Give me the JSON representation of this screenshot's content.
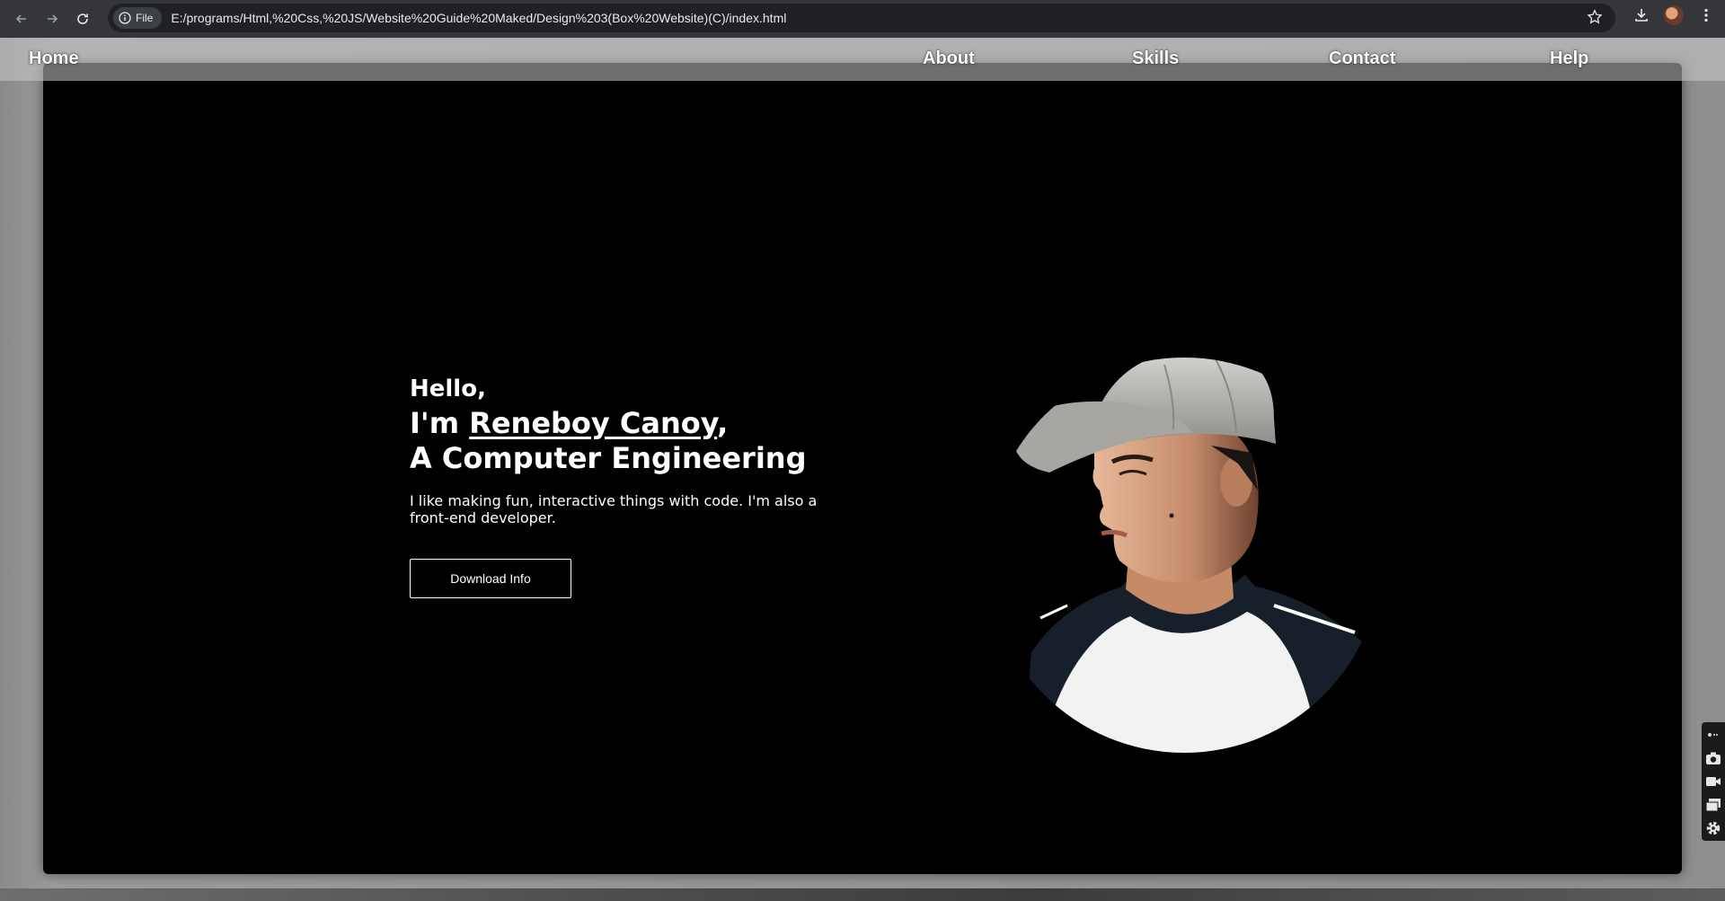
{
  "browser": {
    "scheme_chip": "File",
    "url": "E:/programs/Html,%20Css,%20JS/Website%20Guide%20Maked/Design%203(Box%20Website)(C)/index.html"
  },
  "nav": {
    "home": "Home",
    "about": "About",
    "skills": "Skills",
    "contact": "Contact",
    "help": "Help"
  },
  "hero": {
    "hello": "Hello,",
    "im_prefix": "I'm ",
    "name": "Reneboy Canoy",
    "name_suffix": ",",
    "role": "A Computer Engineering",
    "tagline": "I like making fun, interactive things with code. I'm also a front-end developer.",
    "button_label": "Download Info"
  },
  "icons": {
    "back": "arrow-left-icon",
    "forward": "arrow-right-icon",
    "reload": "reload-icon",
    "info": "info-icon",
    "bookmark": "star-icon",
    "download": "download-icon",
    "menu": "kebab-menu-icon",
    "widget": [
      "link-icon",
      "camera-icon",
      "video-icon",
      "windows-icon",
      "gear-icon"
    ]
  },
  "colors": {
    "chrome_bg": "#35363a",
    "omnibox_bg": "#202124",
    "page_box": "#000000",
    "page_bg": "#8f8f8f",
    "accent_text": "#ffffff"
  }
}
